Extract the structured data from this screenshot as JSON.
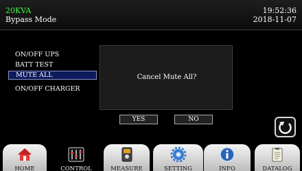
{
  "header": {
    "model": "20KVA",
    "mode": "Bypass Mode",
    "time": "19:52:36",
    "date": "2018-11-07"
  },
  "menu": {
    "items": [
      {
        "label": "ON/OFF UPS"
      },
      {
        "label": "BATT TEST"
      },
      {
        "label": "MUTE ALL"
      },
      {
        "label": "ON/OFF CHARGER"
      }
    ],
    "selected": "MUTE ALL"
  },
  "dialog": {
    "message": "Cancel Mute All?",
    "yes_label": "YES",
    "no_label": "NO"
  },
  "tabs": [
    {
      "label": "HOME",
      "icon": "home-icon"
    },
    {
      "label": "CONTROL",
      "icon": "sliders-icon"
    },
    {
      "label": "MEASURE",
      "icon": "meter-icon"
    },
    {
      "label": "SETTING",
      "icon": "gear-icon"
    },
    {
      "label": "INFO",
      "icon": "info-icon"
    },
    {
      "label": "DATALOG",
      "icon": "clipboard-icon"
    }
  ],
  "active_tab": "CONTROL",
  "colors": {
    "model_text": "#3cff3c",
    "selected_bg": "#0d1a5c",
    "tab_bg": "#e0e0e0"
  }
}
